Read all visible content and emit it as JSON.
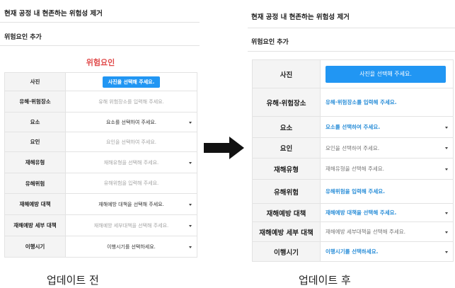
{
  "before": {
    "header_title": "현재 공정 내 현존하는 위험성 제거",
    "subheader": "위험요인 추가",
    "section_title": "위험요인",
    "rows": [
      {
        "label": "사진",
        "type": "button",
        "text": "사진을 선택해 주세요."
      },
      {
        "label": "유해·위험장소",
        "type": "placeholder",
        "text": "유해 위험장소를 입력해 주세요."
      },
      {
        "label": "요소",
        "type": "select",
        "text": "요소를 선택하여 주세요."
      },
      {
        "label": "요인",
        "type": "placeholder",
        "text": "요인을 선택하여 주세요."
      },
      {
        "label": "재해유형",
        "type": "select-ph",
        "text": "재해유형을 선택해 주세요."
      },
      {
        "label": "유해위험",
        "type": "placeholder",
        "text": "유해위험을 입력해 주세요."
      },
      {
        "label": "재해예방 대책",
        "type": "select",
        "text": "재해예방 대책을 선택해 주세요."
      },
      {
        "label": "재해예방 세부 대책",
        "type": "select-ph",
        "text": "재해예방 세부대책을 선택해 주세요."
      },
      {
        "label": "이행시기",
        "type": "select",
        "text": "이행시기를 선택하세요."
      }
    ],
    "caption": "업데이트 전"
  },
  "after": {
    "header_title": "현재 공정 내 현존하는 위험성 제거",
    "subheader": "위험요인 추가",
    "rows": [
      {
        "label": "사진",
        "type": "button",
        "text": "사진을 선택해 주세요."
      },
      {
        "label": "유해·위험장소",
        "type": "blue",
        "text": "유해·위험장소를 입력해 주세요."
      },
      {
        "label": "요소",
        "type": "blue-select",
        "text": "요소를 선택하여 주세요."
      },
      {
        "label": "요인",
        "type": "ph-select",
        "text": "요인을 선택하여 주세요."
      },
      {
        "label": "재해유형",
        "type": "ph-select",
        "text": "재해유형을 선택해 주세요."
      },
      {
        "label": "유해위험",
        "type": "blue",
        "text": "유해위험을 입력해 주세요."
      },
      {
        "label": "재해예방 대책",
        "type": "blue-select",
        "text": "재해예방 대책을 선택해 주세요."
      },
      {
        "label": "재해예방 세부 대책",
        "type": "ph-select",
        "text": "재해예방 세부대책을 선택해 주세요."
      },
      {
        "label": "이행시기",
        "type": "blue-select",
        "text": "이행시기를 선택하세요."
      }
    ],
    "caption": "업데이트 후"
  },
  "colors": {
    "accent": "#2196f3",
    "section_title": "#e04a4a",
    "link_blue": "#2a8ed8",
    "arrow": "#111111"
  },
  "icons": {
    "transition": "right-arrow-icon",
    "dropdown": "caret-down-icon"
  }
}
